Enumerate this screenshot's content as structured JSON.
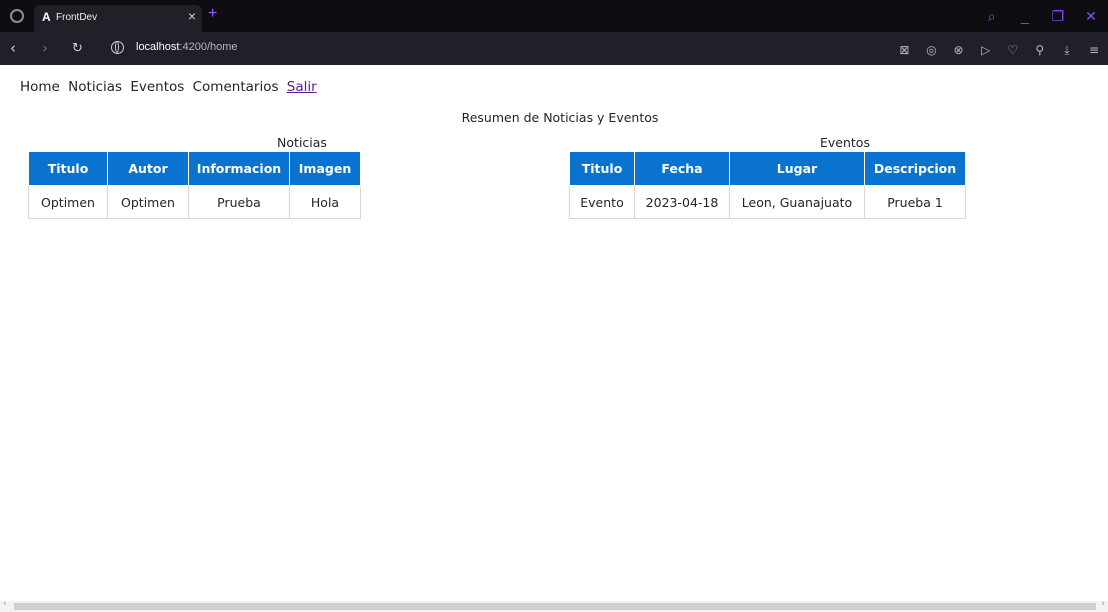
{
  "browser": {
    "tab_logo": "A",
    "tab_title": "FrontDev",
    "tab_close": "×",
    "new_tab": "+",
    "url_host": "localhost",
    "url_path": ":4200/home",
    "window_controls": [
      "⌕",
      "_",
      "❐",
      "✕"
    ],
    "toolbar_icons": [
      "⊠",
      "◎",
      "⊗",
      "▷",
      "♡",
      "⚲",
      "⤓",
      "≡"
    ]
  },
  "nav": {
    "home": "Home",
    "noticias": "Noticias",
    "eventos": "Eventos",
    "comentarios": "Comentarios",
    "salir": "Salir"
  },
  "summary_title": "Resumen de Noticias y Eventos",
  "noticias": {
    "caption": "Noticias",
    "headers": [
      "Titulo",
      "Autor",
      "Informacion",
      "Imagen"
    ],
    "rows": [
      [
        "Optimen",
        "Optimen",
        "Prueba",
        "Hola"
      ]
    ]
  },
  "eventos": {
    "caption": "Eventos",
    "headers": [
      "Titulo",
      "Fecha",
      "Lugar",
      "Descripcion"
    ],
    "rows": [
      [
        "Evento",
        "2023-04-18",
        "Leon, Guanajuato",
        "Prueba 1"
      ]
    ]
  },
  "colors": {
    "header_bg": "#0a73d0",
    "chrome_dark": "#0d0d12",
    "chrome_accent": "#8a4dff"
  }
}
